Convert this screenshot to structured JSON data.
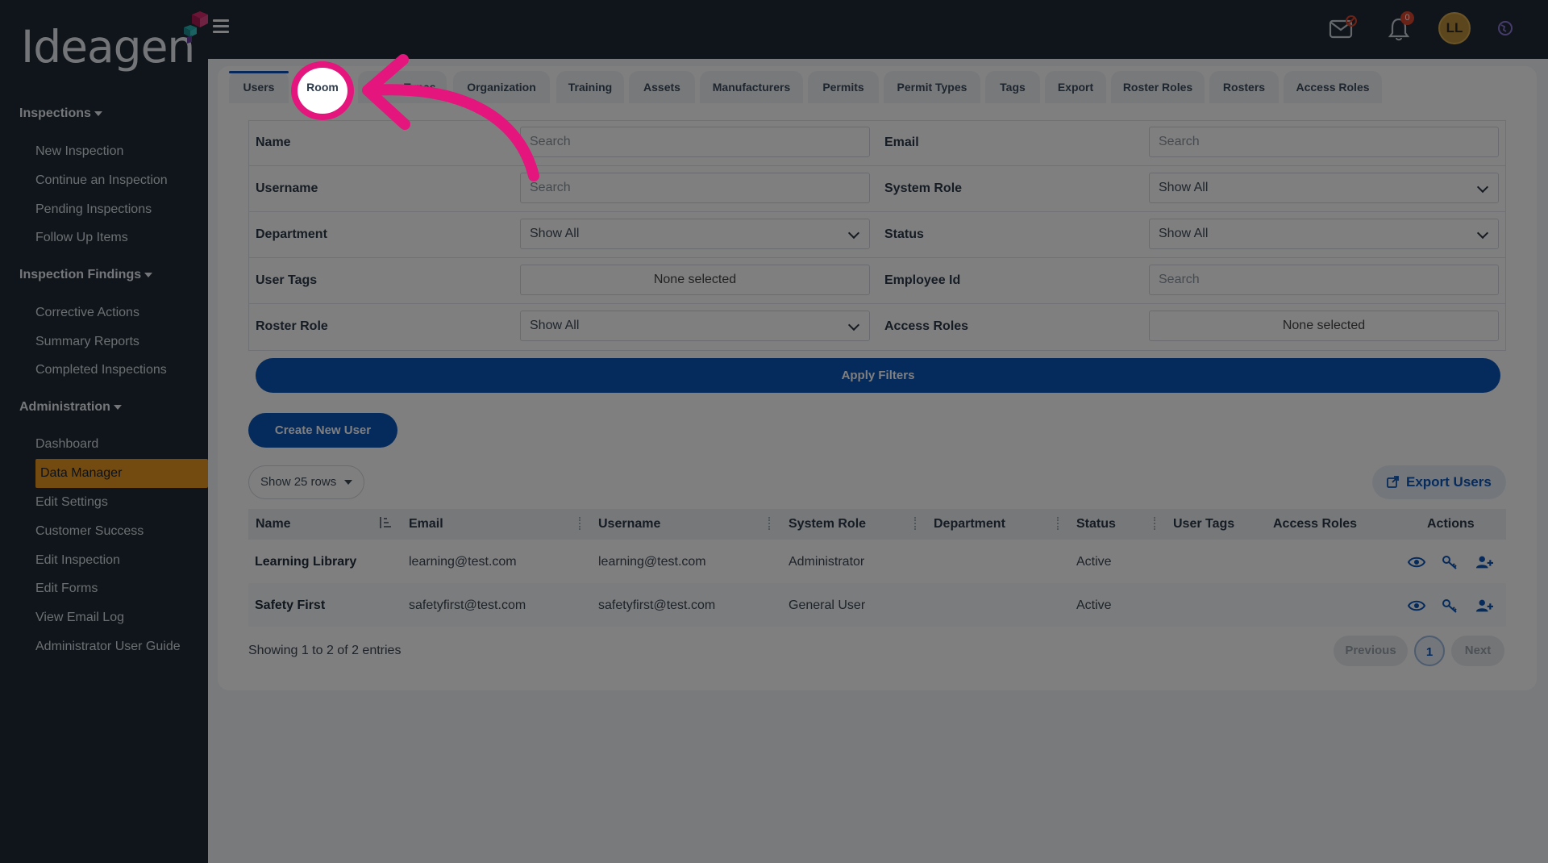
{
  "brand": {
    "logo_text": "Ideagen"
  },
  "sidebar": {
    "sections": [
      {
        "label": "Inspections",
        "items": [
          "New Inspection",
          "Continue an Inspection",
          "Pending Inspections",
          "Follow Up Items"
        ]
      },
      {
        "label": "Inspection Findings",
        "items": [
          "Corrective Actions",
          "Summary Reports",
          "Completed Inspections"
        ]
      },
      {
        "label": "Administration",
        "items": [
          "Dashboard",
          "Data Manager",
          "Edit Settings",
          "Customer Success",
          "Edit Inspection",
          "Edit Forms",
          "View Email Log",
          "Administrator User Guide"
        ]
      }
    ],
    "active_item": "Data Manager"
  },
  "topbar": {
    "notifications_count": "0",
    "avatar_initials": "LL"
  },
  "tabs": [
    "Users",
    "Room",
    "Room Types",
    "Organization",
    "Training",
    "Assets",
    "Manufacturers",
    "Permits",
    "Permit Types",
    "Tags",
    "Export",
    "Roster Roles",
    "Rosters",
    "Access Roles"
  ],
  "filters": {
    "name_label": "Name",
    "name_placeholder": "Search",
    "email_label": "Email",
    "email_placeholder": "Search",
    "username_label": "Username",
    "username_placeholder": "Search",
    "system_role_label": "System Role",
    "system_role_value": "Show All",
    "department_label": "Department",
    "department_value": "Show All",
    "status_label": "Status",
    "status_value": "Show All",
    "user_tags_label": "User Tags",
    "user_tags_value": "None selected",
    "employee_id_label": "Employee Id",
    "employee_id_placeholder": "Search",
    "roster_role_label": "Roster Role",
    "roster_role_value": "Show All",
    "access_roles_label": "Access Roles",
    "access_roles_value": "None selected",
    "apply_label": "Apply Filters"
  },
  "create_user_label": "Create New User",
  "rows_select_label": "Show 25 rows",
  "export_label": "Export Users",
  "table": {
    "columns": [
      "Name",
      "Email",
      "Username",
      "System Role",
      "Department",
      "Status",
      "User Tags",
      "Access Roles",
      "Actions"
    ],
    "rows": [
      {
        "name": "Learning Library",
        "email": "learning@test.com",
        "username": "learning@test.com",
        "system_role": "Administrator",
        "department": "",
        "status": "Active"
      },
      {
        "name": "Safety First",
        "email": "safetyfirst@test.com",
        "username": "safetyfirst@test.com",
        "system_role": "General User",
        "department": "",
        "status": "Active"
      }
    ]
  },
  "pagination": {
    "showing_text": "Showing 1 to 2 of 2 entries",
    "previous_label": "Previous",
    "current_page": "1",
    "next_label": "Next"
  },
  "colors": {
    "primary": "#0a55b8",
    "active_nav": "#e6951f",
    "highlight": "#e4167e",
    "sidebar": "#1e2a35"
  }
}
